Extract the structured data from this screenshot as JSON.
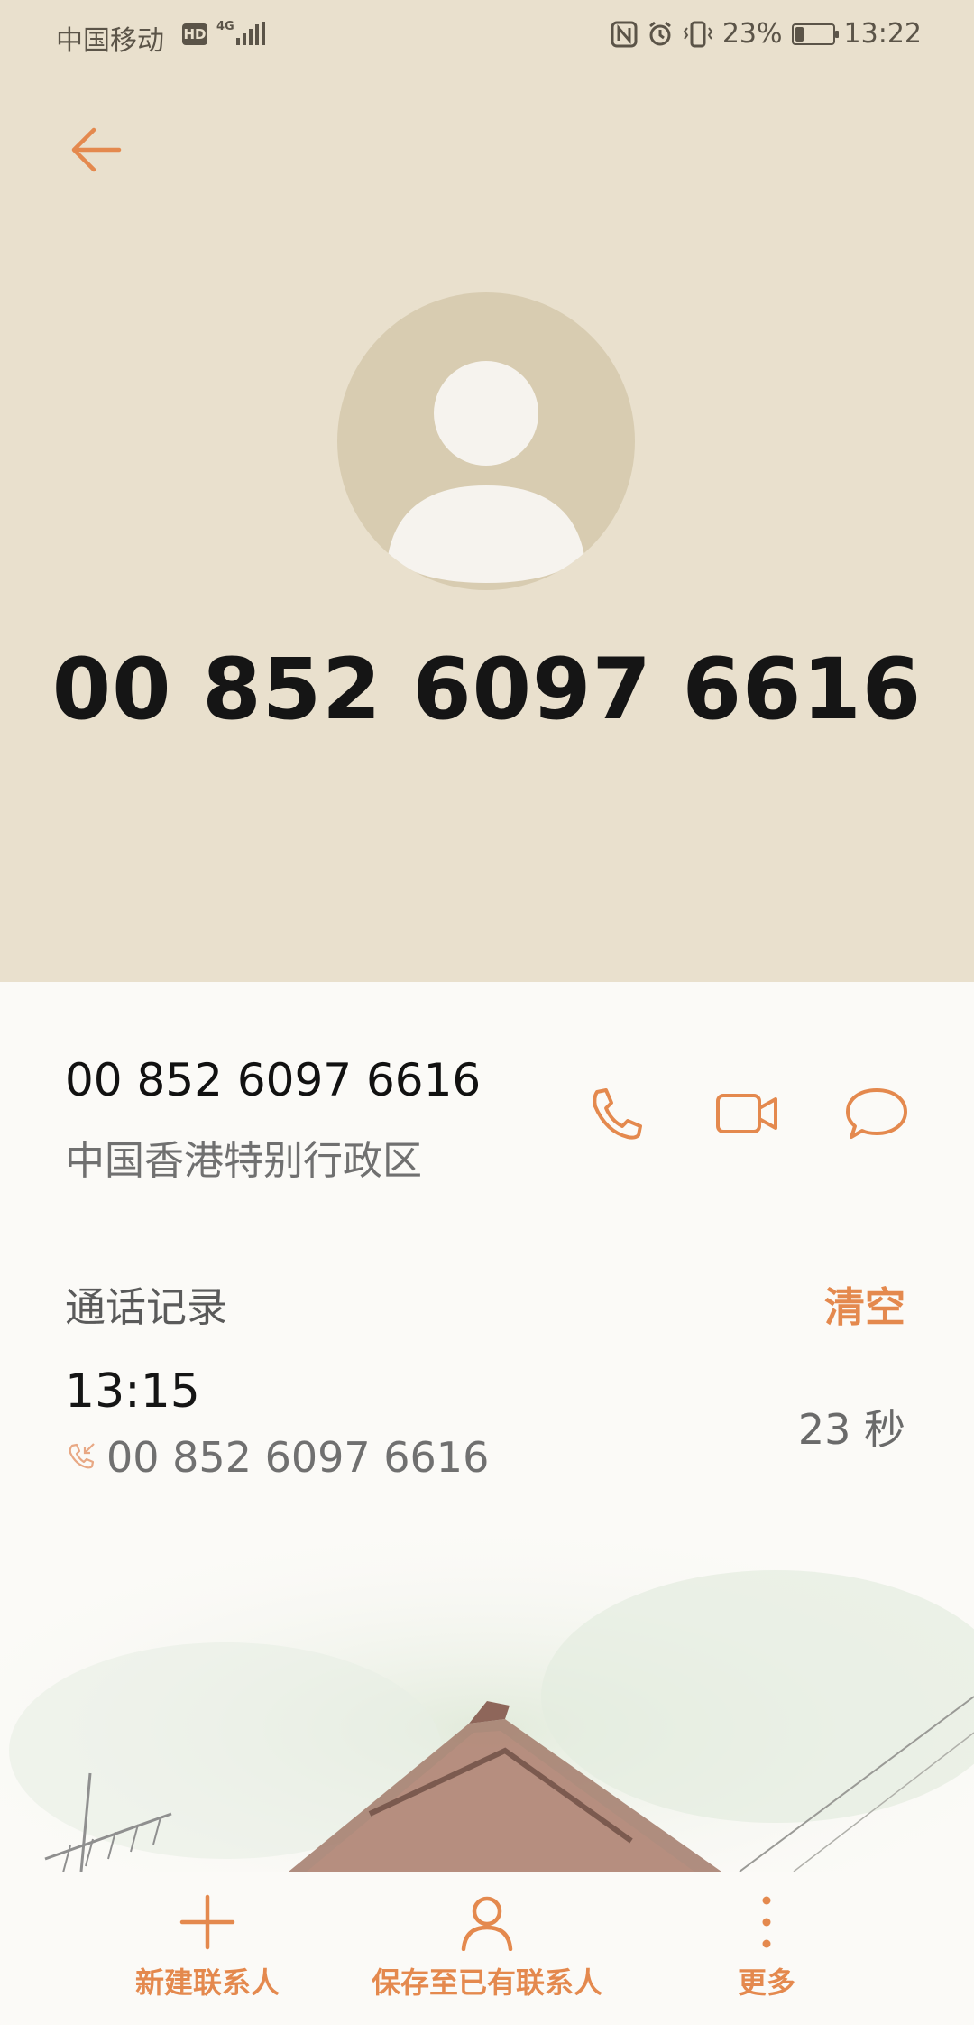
{
  "status_bar": {
    "carrier": "中国移动",
    "hd_badge": "HD",
    "network": "4G",
    "battery": "23%",
    "battery_level": 0.23,
    "time": "13:22"
  },
  "header": {
    "phone_number": "00 852 6097 6616"
  },
  "contact": {
    "number": "00 852 6097 6616",
    "region": "中国香港特别行政区"
  },
  "call_log": {
    "title": "通话记录",
    "clear_label": "清空",
    "entries": [
      {
        "time": "13:15",
        "number": "00 852 6097 6616",
        "duration": "23 秒"
      }
    ]
  },
  "bottom_bar": {
    "new_contact": "新建联系人",
    "save_existing": "保存至已有联系人",
    "more": "更多"
  },
  "colors": {
    "accent": "#e4894e",
    "header_bg": "#e9e0cd",
    "avatar_bg": "#d8ccb1"
  },
  "icons": [
    "back-arrow-icon",
    "phone-icon",
    "video-call-icon",
    "message-icon",
    "incoming-call-icon",
    "plus-icon",
    "person-icon",
    "more-vertical-icon"
  ]
}
